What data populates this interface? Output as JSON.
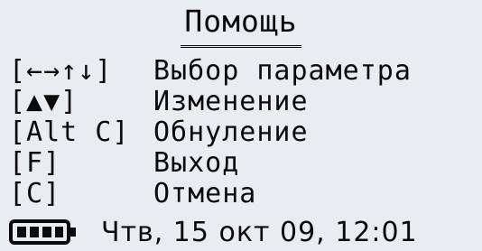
{
  "screen": {
    "title": "Помощь",
    "items": [
      {
        "key": "[←→↑↓]",
        "label": "Выбор параметра"
      },
      {
        "key": "[▲▼]",
        "label": "Изменение"
      },
      {
        "key": "[Alt C]",
        "label": "Обнуление"
      },
      {
        "key": "[F]",
        "label": "Выход"
      },
      {
        "key": "[C]",
        "label": "Отмена"
      }
    ]
  },
  "status": {
    "battery_icon": "battery-full-icon",
    "datetime": "Чтв, 15 окт 09, 12:01"
  }
}
